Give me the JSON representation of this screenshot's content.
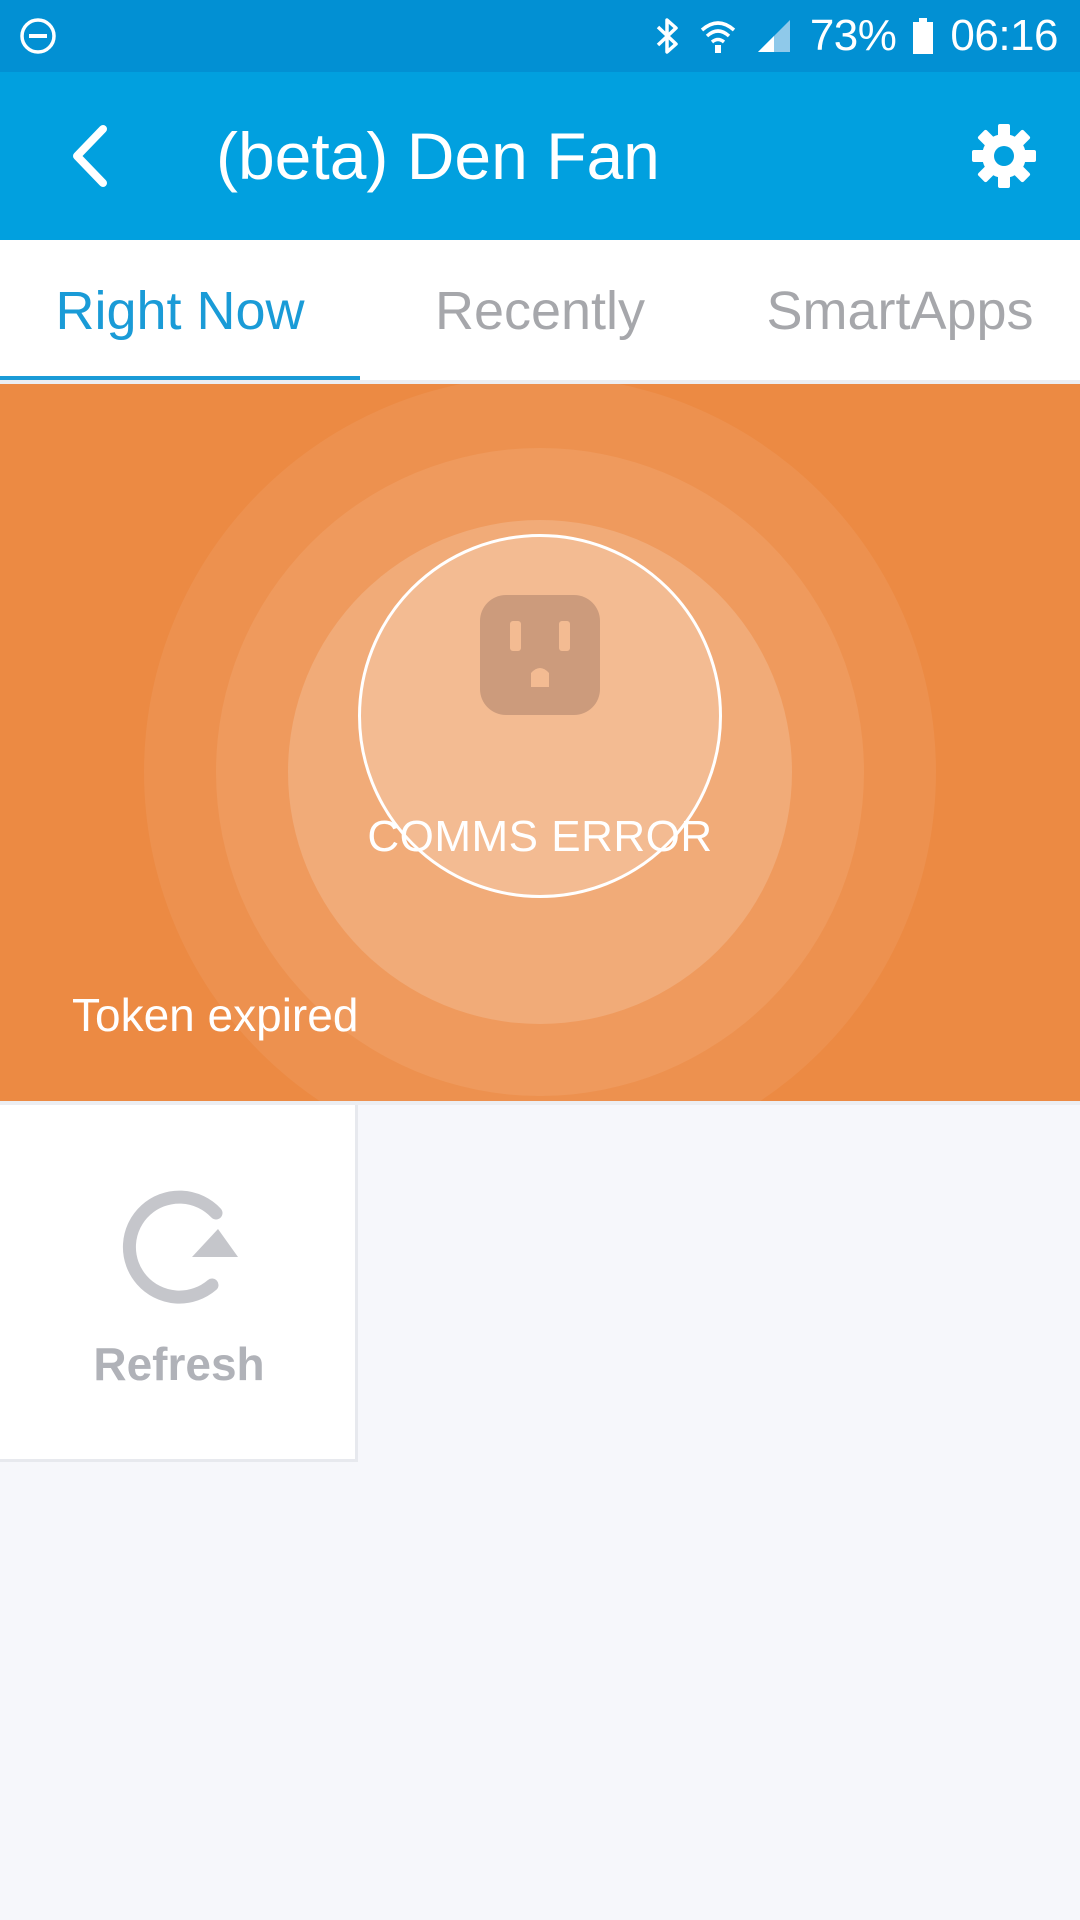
{
  "status_bar": {
    "battery": "73%",
    "time": "06:16",
    "icons": [
      "dnd-icon",
      "bluetooth-icon",
      "wifi-icon",
      "signal-icon",
      "battery-icon"
    ]
  },
  "header": {
    "title": "(beta) Den Fan",
    "back_icon": "back-arrow-icon",
    "settings_icon": "gear-icon",
    "background": "#01a0df"
  },
  "tabs": [
    {
      "label": "Right Now",
      "active": true
    },
    {
      "label": "Recently",
      "active": false
    },
    {
      "label": "SmartApps",
      "active": false
    }
  ],
  "device_status": {
    "icon": "outlet-icon",
    "state": "COMMS ERROR",
    "message": "Token expired",
    "background": "#ec8a43"
  },
  "tiles": [
    {
      "label": "Refresh",
      "icon": "refresh-icon"
    }
  ]
}
